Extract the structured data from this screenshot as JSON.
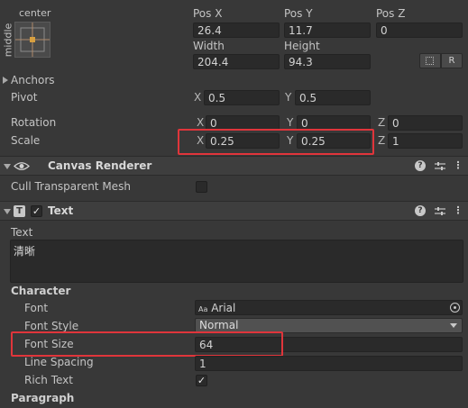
{
  "anchor_preset": {
    "top_label": "center",
    "side_label": "middle"
  },
  "pos": {
    "x_label": "Pos X",
    "y_label": "Pos Y",
    "z_label": "Pos Z",
    "x": "26.4",
    "y": "11.7",
    "z": "0",
    "width_label": "Width",
    "height_label": "Height",
    "width": "204.4",
    "height": "94.3",
    "blueprint_icon": "dotted-square-icon",
    "raw_button": "R"
  },
  "anchors_label": "Anchors",
  "pivot": {
    "label": "Pivot",
    "x_axis": "X",
    "y_axis": "Y",
    "x": "0.5",
    "y": "0.5"
  },
  "rotation": {
    "label": "Rotation",
    "x_axis": "X",
    "y_axis": "Y",
    "z_axis": "Z",
    "x": "0",
    "y": "0",
    "z": "0"
  },
  "scale": {
    "label": "Scale",
    "x_axis": "X",
    "y_axis": "Y",
    "z_axis": "Z",
    "x": "0.25",
    "y": "0.25",
    "z": "1"
  },
  "canvas_renderer": {
    "title": "Canvas Renderer",
    "cull_label": "Cull Transparent Mesh",
    "cull_checked": false
  },
  "text_component": {
    "title": "Text",
    "enabled": true,
    "text_label": "Text",
    "text_value": "清晰",
    "character_label": "Character",
    "font_label": "Font",
    "font_value": "Arial",
    "font_prefix": "Aa",
    "font_style_label": "Font Style",
    "font_style_value": "Normal",
    "font_size_label": "Font Size",
    "font_size_value": "64",
    "line_spacing_label": "Line Spacing",
    "line_spacing_value": "1",
    "rich_text_label": "Rich Text",
    "rich_text_checked": true,
    "paragraph_label": "Paragraph"
  },
  "colors": {
    "highlight": "#e0353b",
    "panel": "#383838",
    "field": "#2a2a2a"
  }
}
